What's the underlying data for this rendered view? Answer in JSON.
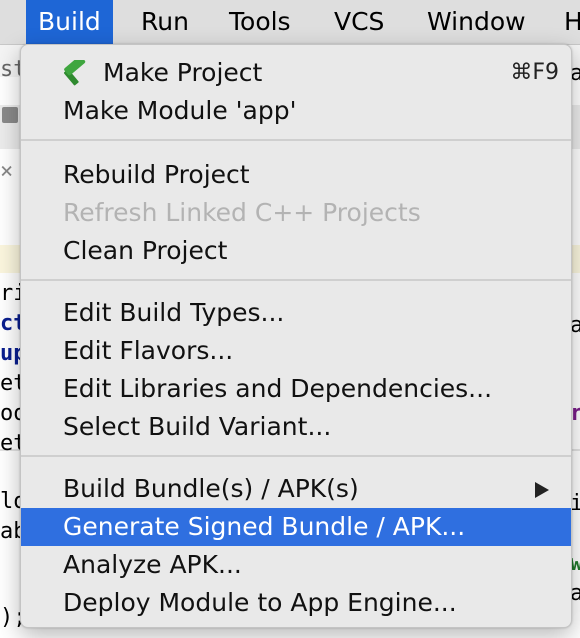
{
  "menubar": {
    "items": [
      {
        "label": "Build",
        "active": true
      },
      {
        "label": "Run"
      },
      {
        "label": "Tools"
      },
      {
        "label": "VCS"
      },
      {
        "label": "Window"
      },
      {
        "label": "H"
      }
    ]
  },
  "background": {
    "fragments": [
      "st/",
      "ri",
      "ct",
      "up",
      "et",
      "oo",
      "et",
      "lo",
      "ab",
      ");",
      "a",
      "a",
      "r",
      "i",
      "w",
      "a"
    ]
  },
  "build_menu": {
    "make_project": {
      "label": "Make Project",
      "shortcut": "⌘F9",
      "icon": "hammer-icon"
    },
    "make_module": {
      "label": "Make Module 'app'"
    },
    "rebuild_project": {
      "label": "Rebuild Project"
    },
    "refresh_cpp": {
      "label": "Refresh Linked C++ Projects",
      "disabled": true
    },
    "clean_project": {
      "label": "Clean Project"
    },
    "edit_build_types": {
      "label": "Edit Build Types..."
    },
    "edit_flavors": {
      "label": "Edit Flavors..."
    },
    "edit_libraries": {
      "label": "Edit Libraries and Dependencies..."
    },
    "select_variant": {
      "label": "Select Build Variant..."
    },
    "build_bundle": {
      "label": "Build Bundle(s) / APK(s)",
      "submenu": true
    },
    "generate_signed": {
      "label": "Generate Signed Bundle / APK...",
      "highlighted": true
    },
    "analyze_apk": {
      "label": "Analyze APK..."
    },
    "deploy_module": {
      "label": "Deploy Module to App Engine..."
    }
  },
  "colors": {
    "accent": "#1e66d6",
    "highlight": "#2f6fe0",
    "disabled_text": "#b3b3b3"
  }
}
